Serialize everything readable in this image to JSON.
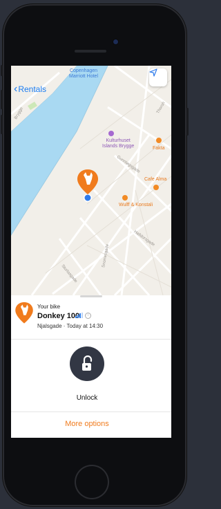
{
  "map": {
    "back_label": "Rentals",
    "labels": {
      "hotel": "Copenhagen Marriott Hotel",
      "hotel_line1": "Copenhagen",
      "hotel_line2": "Marriott Hotel",
      "kulturhuset_line1": "Kulturhuset",
      "kulturhuset_line2": "Islands Brygge",
      "fakta": "Fakta",
      "cafe_alma": "Cafe Alma",
      "wulff": "Wulff & Konstali",
      "brygge": "Brygge",
      "gunnlogsgade": "Gunnløgsgade",
      "snorresgade": "Snorresgade",
      "halldorsgade": "Halldorsgade",
      "sturlasgade": "Sturlasgade",
      "thorshavnsgade": "Thorsh"
    },
    "colors": {
      "water": "#a9d9f2",
      "land": "#f2efe9",
      "road": "#ffffff",
      "park": "#cde8b8"
    }
  },
  "bike": {
    "caption": "Your bike",
    "name": "Donkey 100",
    "location": "Njalsgade · Today at 14:30",
    "brand_color": "#f07b1d"
  },
  "actions": {
    "unlock_label": "Unlock",
    "more_options_label": "More options"
  },
  "icons": {
    "back": "chevron-left-icon",
    "locate": "location-arrow-icon",
    "unlock": "unlocked-padlock-icon",
    "signal": "signal-bars-icon",
    "info": "info-icon",
    "bike_pin": "donkey-pin-icon"
  }
}
